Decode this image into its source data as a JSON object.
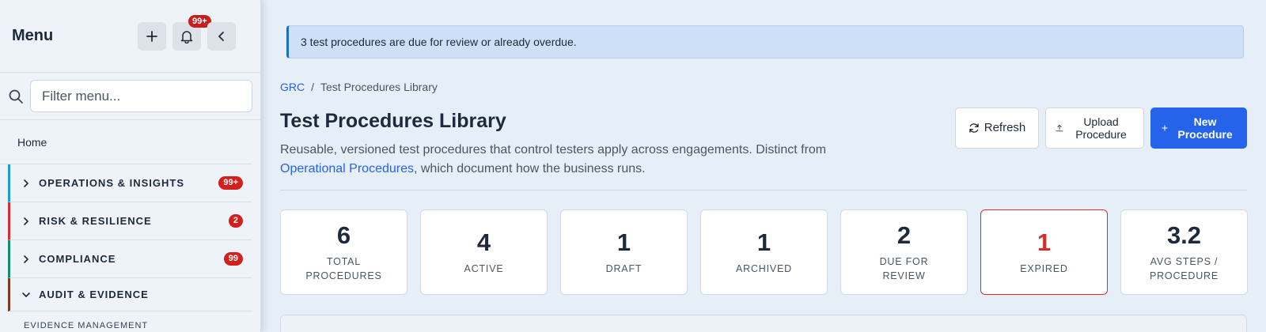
{
  "sidebar": {
    "title": "Menu",
    "notifications_badge": "99+",
    "filter_placeholder": "Filter menu...",
    "home_label": "Home",
    "sections": [
      {
        "label": "OPERATIONS & INSIGHTS",
        "count": "99+",
        "accent": "#1f9bd1",
        "expanded": false
      },
      {
        "label": "RISK & RESILIENCE",
        "count": "2",
        "accent": "#d32f2f",
        "expanded": false
      },
      {
        "label": "COMPLIANCE",
        "count": "99",
        "accent": "#128c6e",
        "expanded": false
      },
      {
        "label": "AUDIT & EVIDENCE",
        "count": "",
        "accent": "#7a3b1e",
        "expanded": true
      }
    ],
    "subsection_label": "EVIDENCE MANAGEMENT"
  },
  "alert": {
    "text": "3 test procedures are due for review or already overdue."
  },
  "breadcrumb": {
    "root": "GRC",
    "separator": "/",
    "current": "Test Procedures Library"
  },
  "page": {
    "title": "Test Procedures Library",
    "description_before": "Reusable, versioned test procedures that control testers apply across engagements. Distinct from ",
    "description_link": "Operational Procedures",
    "description_after": ", which document how the business runs."
  },
  "actions": {
    "refresh_label": "Refresh",
    "upload_label": "Upload Procedure",
    "new_label": "New Procedure"
  },
  "stats": [
    {
      "value": "6",
      "label": "TOTAL PROCEDURES"
    },
    {
      "value": "4",
      "label": "ACTIVE"
    },
    {
      "value": "1",
      "label": "DRAFT"
    },
    {
      "value": "1",
      "label": "ARCHIVED"
    },
    {
      "value": "2",
      "label": "DUE FOR REVIEW"
    },
    {
      "value": "1",
      "label": "EXPIRED"
    },
    {
      "value": "3.2",
      "label": "AVG STEPS / PROCEDURE"
    }
  ],
  "colors": {
    "primary": "#2563eb",
    "danger": "#d32f2f",
    "alert_bg": "#cde0f7"
  }
}
